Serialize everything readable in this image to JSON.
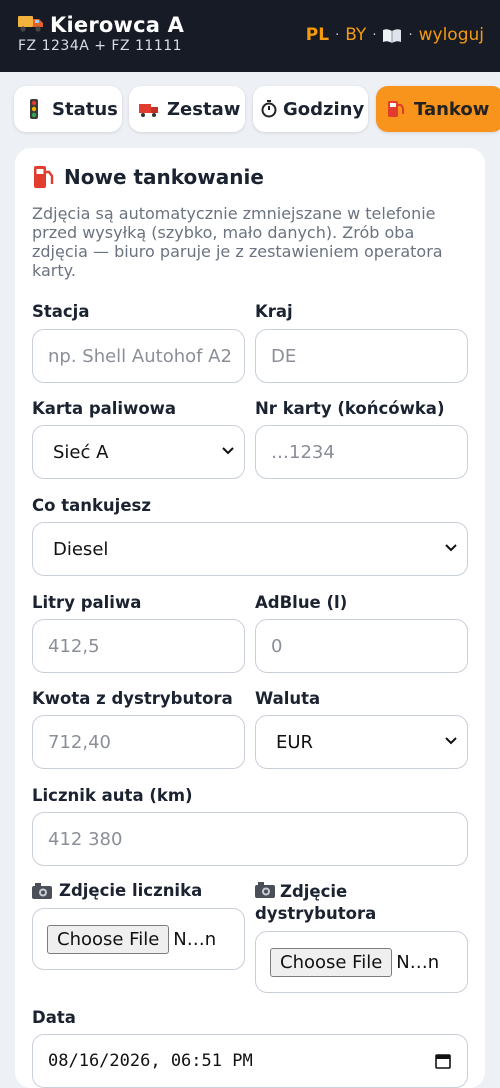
{
  "header": {
    "driver_name": "Kierowca A",
    "plates": "FZ 1234A + FZ 11111",
    "lang_pl": "PL",
    "sep": "·",
    "lang_by": "BY",
    "logout": "wyloguj",
    "truck_icon": "truck-icon",
    "book_icon": "book-icon"
  },
  "tabs": [
    {
      "label": "Status",
      "icon": "traffic-light-icon"
    },
    {
      "label": "Zestaw",
      "icon": "truck-icon"
    },
    {
      "label": "Godziny",
      "icon": "stopwatch-icon"
    },
    {
      "label": "Tankow",
      "icon": "fuel-pump-icon",
      "active": true
    }
  ],
  "form": {
    "title": "Nowe tankowanie",
    "title_icon": "fuel-pump-icon",
    "description": "Zdjęcia są automatycznie zmniejszane w telefonie przed wysyłką (szybko, mało danych). Zrób oba zdjęcia — biuro paruje je z zestawieniem operatora karty.",
    "station": {
      "label": "Stacja",
      "placeholder": "np. Shell Autohof A2"
    },
    "country": {
      "label": "Kraj",
      "placeholder": "DE"
    },
    "card": {
      "label": "Karta paliwowa",
      "value": "Sieć A"
    },
    "card_number": {
      "label": "Nr karty (końcówka)",
      "placeholder": "…1234"
    },
    "fuel_type": {
      "label": "Co tankujesz",
      "value": "Diesel"
    },
    "liters": {
      "label": "Litry paliwa",
      "placeholder": "412,5"
    },
    "adblue": {
      "label": "AdBlue (l)",
      "placeholder": "0"
    },
    "amount": {
      "label": "Kwota z dystrybutora",
      "placeholder": "712,40"
    },
    "currency": {
      "label": "Waluta",
      "value": "EUR"
    },
    "odometer": {
      "label": "Licznik auta (km)",
      "placeholder": "412 380"
    },
    "photo_odometer": {
      "label": "Zdjęcie licznika",
      "icon": "camera-icon",
      "button": "Choose File",
      "file": "N…n"
    },
    "photo_pump": {
      "label": "Zdjęcie dystrybutora",
      "icon": "camera-icon",
      "button": "Choose File",
      "file": "N…n"
    },
    "date": {
      "label": "Data",
      "value": "08/16/2026, 06:51 PM"
    }
  },
  "colors": {
    "accent": "#f8931c",
    "header_bg": "#161b26",
    "page_bg": "#edf0f5"
  }
}
